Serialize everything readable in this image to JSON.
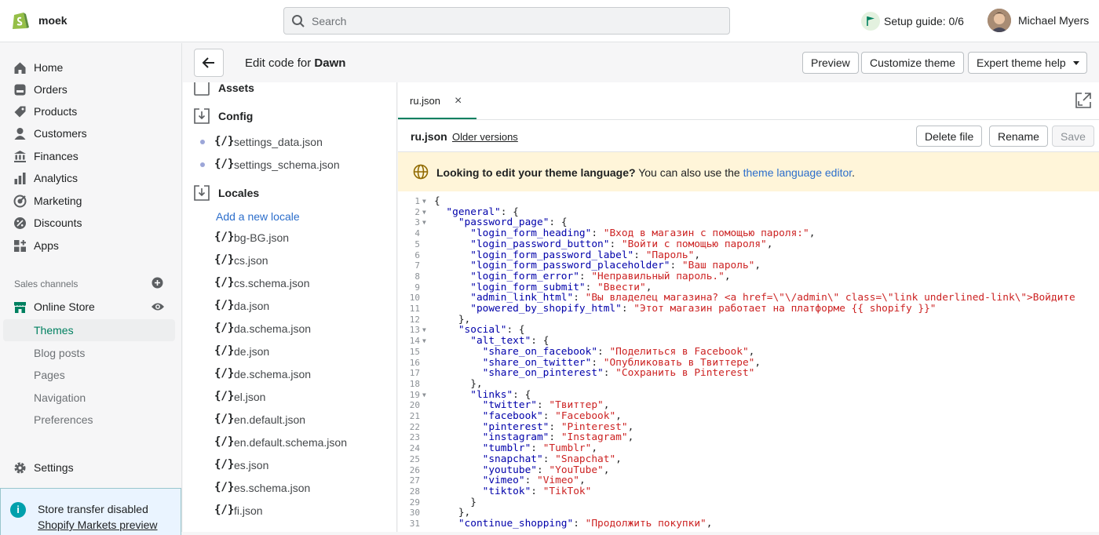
{
  "topbar": {
    "store_name": "moek",
    "search_placeholder": "Search",
    "setup_guide": "Setup guide: 0/6",
    "user_name": "Michael Myers"
  },
  "sidebar": {
    "items": [
      {
        "label": "Home",
        "icon": "home-icon"
      },
      {
        "label": "Orders",
        "icon": "orders-icon"
      },
      {
        "label": "Products",
        "icon": "products-icon"
      },
      {
        "label": "Customers",
        "icon": "customers-icon"
      },
      {
        "label": "Finances",
        "icon": "finances-icon"
      },
      {
        "label": "Analytics",
        "icon": "analytics-icon"
      },
      {
        "label": "Marketing",
        "icon": "marketing-icon"
      },
      {
        "label": "Discounts",
        "icon": "discounts-icon"
      },
      {
        "label": "Apps",
        "icon": "apps-icon"
      }
    ],
    "sales_channels_title": "Sales channels",
    "online_store": "Online Store",
    "sub_items": [
      {
        "label": "Themes",
        "active": true
      },
      {
        "label": "Blog posts",
        "active": false
      },
      {
        "label": "Pages",
        "active": false
      },
      {
        "label": "Navigation",
        "active": false
      },
      {
        "label": "Preferences",
        "active": false
      }
    ],
    "settings": "Settings",
    "notice_title": "Store transfer disabled",
    "notice_link": "Shopify Markets preview"
  },
  "header": {
    "edit_prefix": "Edit code for ",
    "theme_name": "Dawn",
    "preview": "Preview",
    "customize": "Customize theme",
    "expert_help": "Expert theme help"
  },
  "filetree": {
    "assets": "Assets",
    "config": "Config",
    "config_files": [
      "settings_data.json",
      "settings_schema.json"
    ],
    "locales": "Locales",
    "add_locale": "Add a new locale",
    "locale_files": [
      "bg-BG.json",
      "cs.json",
      "cs.schema.json",
      "da.json",
      "da.schema.json",
      "de.json",
      "de.schema.json",
      "el.json",
      "en.default.json",
      "en.default.schema.json",
      "es.json",
      "es.schema.json",
      "fi.json"
    ],
    "file_icon": "{/}"
  },
  "editor": {
    "tab_label": "ru.json",
    "tab_close": "×",
    "file_name": "ru.json",
    "older_versions": "Older versions",
    "delete_file": "Delete file",
    "rename": "Rename",
    "save": "Save",
    "banner_bold": "Looking to edit your theme language?",
    "banner_text": " You can also use the ",
    "banner_link": "theme language editor",
    "banner_end": ".",
    "lines": [
      {
        "n": "1",
        "f": true,
        "parts": [
          [
            "o",
            "{"
          ]
        ]
      },
      {
        "n": "2",
        "f": true,
        "parts": [
          [
            "o",
            "  "
          ],
          [
            "k",
            "\"general\""
          ],
          [
            "o",
            ": {"
          ]
        ]
      },
      {
        "n": "3",
        "f": true,
        "parts": [
          [
            "o",
            "    "
          ],
          [
            "k",
            "\"password_page\""
          ],
          [
            "o",
            ": {"
          ]
        ]
      },
      {
        "n": "4",
        "f": false,
        "parts": [
          [
            "o",
            "      "
          ],
          [
            "k",
            "\"login_form_heading\""
          ],
          [
            "o",
            ": "
          ],
          [
            "s",
            "\"Вход в магазин с помощью пароля:\""
          ],
          [
            "o",
            ","
          ]
        ]
      },
      {
        "n": "5",
        "f": false,
        "parts": [
          [
            "o",
            "      "
          ],
          [
            "k",
            "\"login_password_button\""
          ],
          [
            "o",
            ": "
          ],
          [
            "s",
            "\"Войти с помощью пароля\""
          ],
          [
            "o",
            ","
          ]
        ]
      },
      {
        "n": "6",
        "f": false,
        "parts": [
          [
            "o",
            "      "
          ],
          [
            "k",
            "\"login_form_password_label\""
          ],
          [
            "o",
            ": "
          ],
          [
            "s",
            "\"Пароль\""
          ],
          [
            "o",
            ","
          ]
        ]
      },
      {
        "n": "7",
        "f": false,
        "parts": [
          [
            "o",
            "      "
          ],
          [
            "k",
            "\"login_form_password_placeholder\""
          ],
          [
            "o",
            ": "
          ],
          [
            "s",
            "\"Ваш пароль\""
          ],
          [
            "o",
            ","
          ]
        ]
      },
      {
        "n": "8",
        "f": false,
        "parts": [
          [
            "o",
            "      "
          ],
          [
            "k",
            "\"login_form_error\""
          ],
          [
            "o",
            ": "
          ],
          [
            "s",
            "\"Неправильный пароль.\""
          ],
          [
            "o",
            ","
          ]
        ]
      },
      {
        "n": "9",
        "f": false,
        "parts": [
          [
            "o",
            "      "
          ],
          [
            "k",
            "\"login_form_submit\""
          ],
          [
            "o",
            ": "
          ],
          [
            "s",
            "\"Ввести\""
          ],
          [
            "o",
            ","
          ]
        ]
      },
      {
        "n": "10",
        "f": false,
        "parts": [
          [
            "o",
            "      "
          ],
          [
            "k",
            "\"admin_link_html\""
          ],
          [
            "o",
            ": "
          ],
          [
            "s",
            "\"Вы владелец магазина? <a href=\\\"\\/admin\\\" class=\\\"link underlined-link\\\">Войдите"
          ]
        ]
      },
      {
        "n": "11",
        "f": false,
        "parts": [
          [
            "o",
            "      "
          ],
          [
            "k",
            "\"powered_by_shopify_html\""
          ],
          [
            "o",
            ": "
          ],
          [
            "s",
            "\"Этот магазин работает на платформе {{ shopify }}\""
          ]
        ]
      },
      {
        "n": "12",
        "f": false,
        "parts": [
          [
            "o",
            "    },"
          ]
        ]
      },
      {
        "n": "13",
        "f": true,
        "parts": [
          [
            "o",
            "    "
          ],
          [
            "k",
            "\"social\""
          ],
          [
            "o",
            ": {"
          ]
        ]
      },
      {
        "n": "14",
        "f": true,
        "parts": [
          [
            "o",
            "      "
          ],
          [
            "k",
            "\"alt_text\""
          ],
          [
            "o",
            ": {"
          ]
        ]
      },
      {
        "n": "15",
        "f": false,
        "parts": [
          [
            "o",
            "        "
          ],
          [
            "k",
            "\"share_on_facebook\""
          ],
          [
            "o",
            ": "
          ],
          [
            "s",
            "\"Поделиться в Facebook\""
          ],
          [
            "o",
            ","
          ]
        ]
      },
      {
        "n": "16",
        "f": false,
        "parts": [
          [
            "o",
            "        "
          ],
          [
            "k",
            "\"share_on_twitter\""
          ],
          [
            "o",
            ": "
          ],
          [
            "s",
            "\"Опубликовать в Твиттере\""
          ],
          [
            "o",
            ","
          ]
        ]
      },
      {
        "n": "17",
        "f": false,
        "parts": [
          [
            "o",
            "        "
          ],
          [
            "k",
            "\"share_on_pinterest\""
          ],
          [
            "o",
            ": "
          ],
          [
            "s",
            "\"Сохранить в Pinterest\""
          ]
        ]
      },
      {
        "n": "18",
        "f": false,
        "parts": [
          [
            "o",
            "      },"
          ]
        ]
      },
      {
        "n": "19",
        "f": true,
        "parts": [
          [
            "o",
            "      "
          ],
          [
            "k",
            "\"links\""
          ],
          [
            "o",
            ": {"
          ]
        ]
      },
      {
        "n": "20",
        "f": false,
        "parts": [
          [
            "o",
            "        "
          ],
          [
            "k",
            "\"twitter\""
          ],
          [
            "o",
            ": "
          ],
          [
            "s",
            "\"Твиттер\""
          ],
          [
            "o",
            ","
          ]
        ]
      },
      {
        "n": "21",
        "f": false,
        "parts": [
          [
            "o",
            "        "
          ],
          [
            "k",
            "\"facebook\""
          ],
          [
            "o",
            ": "
          ],
          [
            "s",
            "\"Facebook\""
          ],
          [
            "o",
            ","
          ]
        ]
      },
      {
        "n": "22",
        "f": false,
        "parts": [
          [
            "o",
            "        "
          ],
          [
            "k",
            "\"pinterest\""
          ],
          [
            "o",
            ": "
          ],
          [
            "s",
            "\"Pinterest\""
          ],
          [
            "o",
            ","
          ]
        ]
      },
      {
        "n": "23",
        "f": false,
        "parts": [
          [
            "o",
            "        "
          ],
          [
            "k",
            "\"instagram\""
          ],
          [
            "o",
            ": "
          ],
          [
            "s",
            "\"Instagram\""
          ],
          [
            "o",
            ","
          ]
        ]
      },
      {
        "n": "24",
        "f": false,
        "parts": [
          [
            "o",
            "        "
          ],
          [
            "k",
            "\"tumblr\""
          ],
          [
            "o",
            ": "
          ],
          [
            "s",
            "\"Tumblr\""
          ],
          [
            "o",
            ","
          ]
        ]
      },
      {
        "n": "25",
        "f": false,
        "parts": [
          [
            "o",
            "        "
          ],
          [
            "k",
            "\"snapchat\""
          ],
          [
            "o",
            ": "
          ],
          [
            "s",
            "\"Snapchat\""
          ],
          [
            "o",
            ","
          ]
        ]
      },
      {
        "n": "26",
        "f": false,
        "parts": [
          [
            "o",
            "        "
          ],
          [
            "k",
            "\"youtube\""
          ],
          [
            "o",
            ": "
          ],
          [
            "s",
            "\"YouTube\""
          ],
          [
            "o",
            ","
          ]
        ]
      },
      {
        "n": "27",
        "f": false,
        "parts": [
          [
            "o",
            "        "
          ],
          [
            "k",
            "\"vimeo\""
          ],
          [
            "o",
            ": "
          ],
          [
            "s",
            "\"Vimeo\""
          ],
          [
            "o",
            ","
          ]
        ]
      },
      {
        "n": "28",
        "f": false,
        "parts": [
          [
            "o",
            "        "
          ],
          [
            "k",
            "\"tiktok\""
          ],
          [
            "o",
            ": "
          ],
          [
            "s",
            "\"TikTok\""
          ]
        ]
      },
      {
        "n": "29",
        "f": false,
        "parts": [
          [
            "o",
            "      }"
          ]
        ]
      },
      {
        "n": "30",
        "f": false,
        "parts": [
          [
            "o",
            "    },"
          ]
        ]
      },
      {
        "n": "31",
        "f": false,
        "parts": [
          [
            "o",
            "    "
          ],
          [
            "k",
            "\"continue_shopping\""
          ],
          [
            "o",
            ": "
          ],
          [
            "s",
            "\"Продолжить покупки\""
          ],
          [
            "o",
            ","
          ]
        ]
      }
    ]
  }
}
